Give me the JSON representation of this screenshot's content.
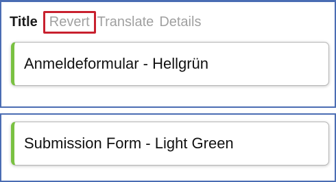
{
  "tabs": {
    "title": "Title",
    "revert": "Revert",
    "translate": "Translate",
    "details": "Details"
  },
  "source_field": {
    "value": "Anmeldeformular - Hellgrün"
  },
  "translation_field": {
    "value": "Submission Form - Light Green"
  },
  "colors": {
    "frame_border": "#4a6cb3",
    "highlight_border": "#c8202e",
    "card_accent": "#7ac142"
  }
}
